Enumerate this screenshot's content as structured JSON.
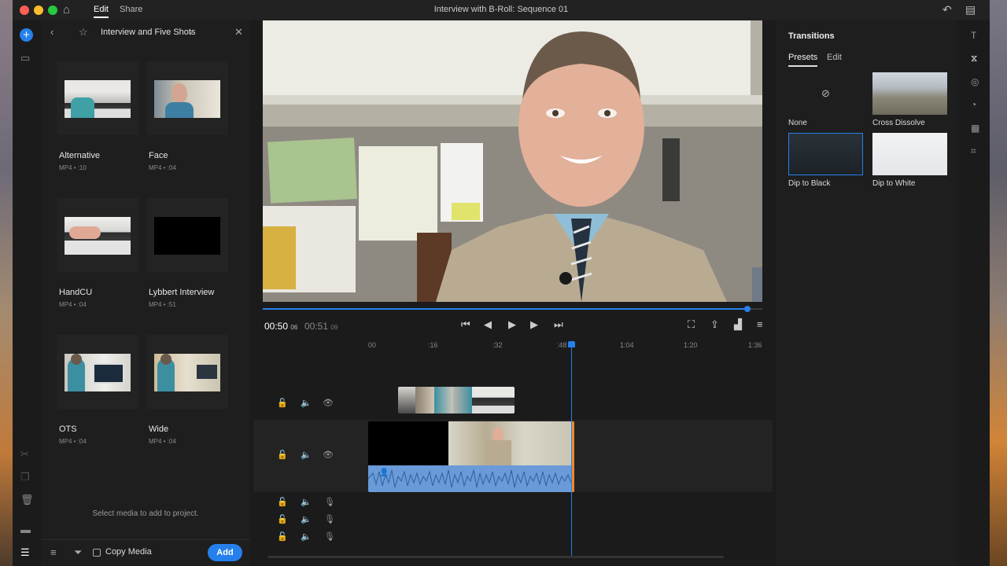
{
  "window": {
    "title": "Interview with B-Roll: Sequence 01",
    "tabs": [
      {
        "label": "Edit"
      },
      {
        "label": "Share"
      }
    ]
  },
  "media_panel": {
    "title": "Interview and Five Shots",
    "clips": [
      {
        "name": "Alternative",
        "meta": "MP4 • :10"
      },
      {
        "name": "Face",
        "meta": "MP4 • :04"
      },
      {
        "name": "HandCU",
        "meta": "MP4 • :04"
      },
      {
        "name": "Lybbert Interview",
        "meta": "MP4 • :51"
      },
      {
        "name": "OTS",
        "meta": "MP4 • :04"
      },
      {
        "name": "Wide",
        "meta": "MP4 • :04"
      }
    ],
    "empty_message": "Select media to add to project.",
    "copy_media_label": "Copy Media",
    "add_label": "Add"
  },
  "player": {
    "current": "00:50",
    "current_frame": "06",
    "duration": "00:51",
    "duration_frame": "09",
    "progress": 0.97
  },
  "transitions": {
    "title": "Transitions",
    "tabs": [
      {
        "label": "Presets"
      },
      {
        "label": "Edit"
      }
    ],
    "presets": [
      {
        "label": "None"
      },
      {
        "label": "Cross Dissolve"
      },
      {
        "label": "Dip to Black"
      },
      {
        "label": "Dip to White"
      }
    ]
  },
  "timeline": {
    "ruler": [
      "00",
      ":16",
      ":32",
      ":48",
      "1:04",
      "1:20",
      "1:36"
    ]
  },
  "colors": {
    "accent": "#2680eb",
    "clip_edge": "#f0882a",
    "audio": "#6a9bd8"
  }
}
